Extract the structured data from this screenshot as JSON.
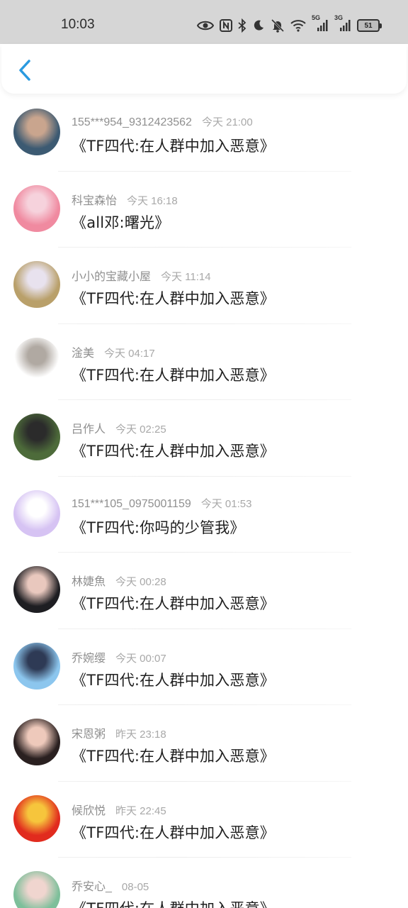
{
  "status_bar": {
    "time": "10:03",
    "icons": [
      "eye-icon",
      "nfc-icon",
      "bluetooth-icon",
      "moon-icon",
      "bell-off-icon",
      "wifi-icon",
      "signal-5g-icon",
      "signal-3g-icon",
      "battery-icon"
    ],
    "net1": "5G",
    "net2": "3G",
    "battery": "51"
  },
  "header": {
    "back_icon": "chevron-left-icon",
    "accent": "#2a9ae0"
  },
  "messages": [
    {
      "name": "155***954_9312423562",
      "time": "今天  21:00",
      "text": "《TF四代:在人群中加入恶意》",
      "avatar_colors": [
        "#3c5a72",
        "#c9a58e"
      ]
    },
    {
      "name": "科宝森怡",
      "time": "今天  16:18",
      "text": "《all邓:曙光》",
      "avatar_colors": [
        "#f08aa0",
        "#f6d2dc"
      ]
    },
    {
      "name": "小小的宝藏小屋",
      "time": "今天  11:14",
      "text": "《TF四代:在人群中加入恶意》",
      "avatar_colors": [
        "#b9a06a",
        "#e8e2ee"
      ]
    },
    {
      "name": "淦美",
      "time": "今天  04:17",
      "text": "《TF四代:在人群中加入恶意》",
      "avatar_colors": [
        "#ffffff",
        "#b0a9a2"
      ]
    },
    {
      "name": "吕作人",
      "time": "今天  02:25",
      "text": "《TF四代:在人群中加入恶意》",
      "avatar_colors": [
        "#4d6b3a",
        "#2b2b2b"
      ]
    },
    {
      "name": "151***105_0975001159",
      "time": "今天  01:53",
      "text": "《TF四代:你吗的少管我》",
      "avatar_colors": [
        "#d6c3f3",
        "#ffffff"
      ]
    },
    {
      "name": "林婕魚",
      "time": "今天  00:28",
      "text": "《TF四代:在人群中加入恶意》",
      "avatar_colors": [
        "#1e1e22",
        "#e9c8be"
      ]
    },
    {
      "name": "乔婉缨",
      "time": "今天  00:07",
      "text": "《TF四代:在人群中加入恶意》",
      "avatar_colors": [
        "#8cc6ee",
        "#2e3a55"
      ]
    },
    {
      "name": "宋恩粥",
      "time": "昨天  23:18",
      "text": "《TF四代:在人群中加入恶意》",
      "avatar_colors": [
        "#2a2020",
        "#eec9bb"
      ]
    },
    {
      "name": "候欣悦",
      "time": "昨天  22:45",
      "text": "《TF四代:在人群中加入恶意》",
      "avatar_colors": [
        "#e12b1e",
        "#f6c53c"
      ]
    },
    {
      "name": "乔安心_",
      "time": "08-05",
      "text": "《TF四代:在人群中加入恶意》",
      "avatar_colors": [
        "#7dbf9a",
        "#f0d5cf"
      ]
    }
  ]
}
